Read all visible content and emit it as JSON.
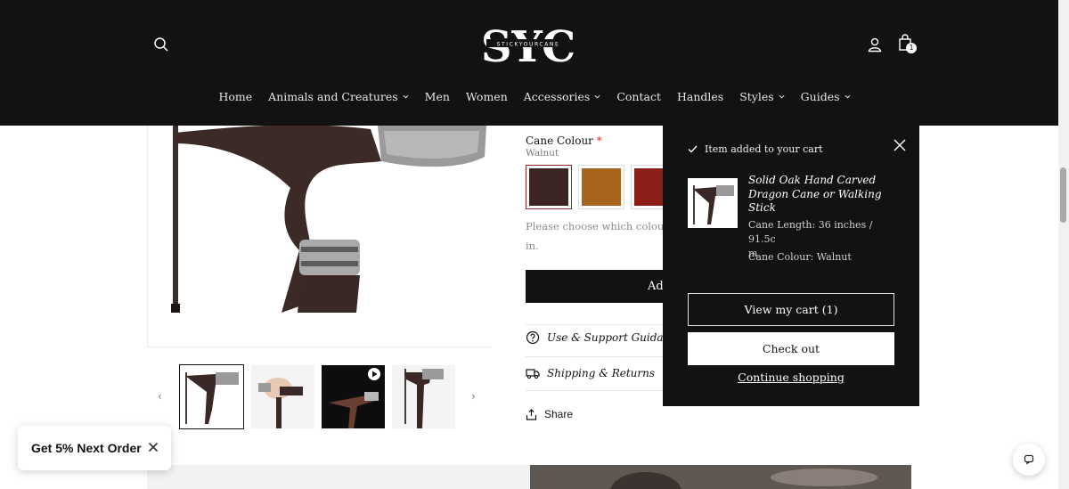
{
  "header": {
    "logo_text": "SYC",
    "logo_tagline": "STICKYOURCANE",
    "cart_count": "1",
    "nav": [
      {
        "label": "Home",
        "has_dropdown": false
      },
      {
        "label": "Animals and Creatures",
        "has_dropdown": true
      },
      {
        "label": "Men",
        "has_dropdown": false
      },
      {
        "label": "Women",
        "has_dropdown": false
      },
      {
        "label": "Accessories",
        "has_dropdown": true
      },
      {
        "label": "Contact",
        "has_dropdown": false
      },
      {
        "label": "Handles",
        "has_dropdown": false
      },
      {
        "label": "Styles",
        "has_dropdown": true
      },
      {
        "label": "Guides",
        "has_dropdown": true
      }
    ],
    "icons": {
      "search": "search-icon",
      "account": "account-icon",
      "cart": "cart-icon"
    }
  },
  "product": {
    "colour_label": "Cane Colour",
    "required_mark": "*",
    "colour_value": "Walnut",
    "swatches": [
      {
        "name": "walnut",
        "color": "#3a2522",
        "selected": true
      },
      {
        "name": "honey",
        "color": "#a8641f",
        "selected": false
      },
      {
        "name": "red",
        "color": "#8d1d17",
        "selected": false
      }
    ],
    "helper_line1": "Please choose which colour",
    "helper_line2": "in.",
    "add_button_label": "Ad",
    "collapsibles": [
      {
        "label": "Use & Support Guidanc",
        "icon": "question-circle-icon"
      },
      {
        "label": "Shipping & Returns",
        "icon": "truck-icon"
      }
    ],
    "share_label": "Share"
  },
  "cart_popup": {
    "heading": "Item added to your cart",
    "item_title": "Solid Oak Hand Carved Dragon Cane or Walking Stick",
    "option_length": "Cane Length: 36 inches / 91.5c\nm",
    "option_length_line1": "Cane Length: 36 inches / 91.5c",
    "option_length_line2": "m",
    "option_colour": "Cane Colour: Walnut",
    "view_cart_label": "View my cart (1)",
    "checkout_label": "Check out",
    "continue_label": "Continue shopping"
  },
  "promo": {
    "label": "Get 5% Next Order"
  },
  "colors": {
    "header_bg": "#121212",
    "accent_required": "#c0392b",
    "swatch_selected_border": "#8a2b2b"
  }
}
